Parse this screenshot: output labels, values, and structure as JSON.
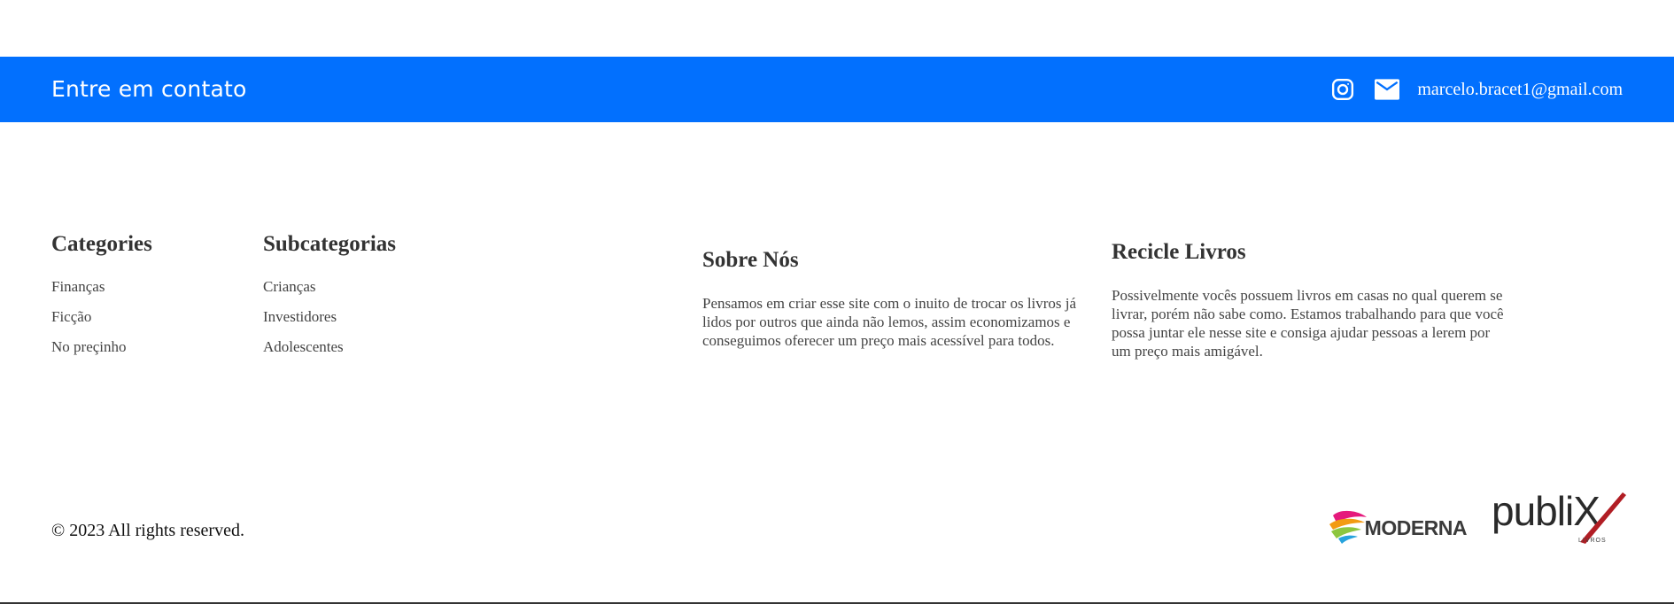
{
  "contact": {
    "title": "Entre em contato",
    "instagram_icon": "instagram-icon",
    "mail_icon": "mail-icon",
    "email": "marcelo.bracet1@gmail.com"
  },
  "footer": {
    "categories": {
      "title": "Categories",
      "items": [
        "Finanças",
        "Ficção",
        "No preçinho"
      ]
    },
    "subcategories": {
      "title": "Subcategorias",
      "items": [
        "Crianças",
        "Investidores",
        "Adolescentes"
      ]
    },
    "about": {
      "title": "Sobre Nós",
      "text": "Pensamos em criar esse site com o inuito de trocar os livros já lidos por outros que ainda não lemos, assim economizamos e conseguimos oferecer um preço mais acessível para todos."
    },
    "recycle": {
      "title": "Recicle Livros",
      "text": "Possivelmente vocês possuem livros em casas no qual querem se livrar, porém não sabe como. Estamos trabalhando para que você possa juntar ele nesse site e consiga ajudar pessoas a lerem por um preço mais amigável."
    },
    "copyright": "© 2023 All rights reserved.",
    "logos": {
      "moderna": "MODERNA",
      "publix": "publiX",
      "publix_sub": "LIVROS"
    }
  },
  "colors": {
    "contact_bar": "#0270fe",
    "text": "#333333"
  }
}
